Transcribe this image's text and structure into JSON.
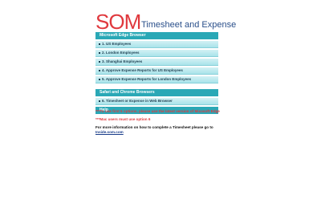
{
  "header": {
    "logo": "SOM",
    "subtitle": "Timesheet and Expense"
  },
  "menu": {
    "edge": {
      "title": "Microsoft Edge Browser",
      "items": [
        "1. US Employees",
        "2. London Employees",
        "3. Shanghai Employees",
        "4. Approve Expense Reports for US Employees",
        "5. Approve Expense Reports for London Employees"
      ]
    },
    "chrome": {
      "title": "Safari and Chrome Browsers",
      "items": [
        "6. Timesheet or Expense in Web Browser"
      ]
    },
    "help": "Help"
  },
  "notes": {
    "red1": "***To use first 5 options, please use the latest version of Micosoft Edge",
    "red2": "***Mac users must use option 6",
    "info_prefix": "For more information on how to complete a Timesheet please go to ",
    "info_link": "Inside.som.com"
  }
}
